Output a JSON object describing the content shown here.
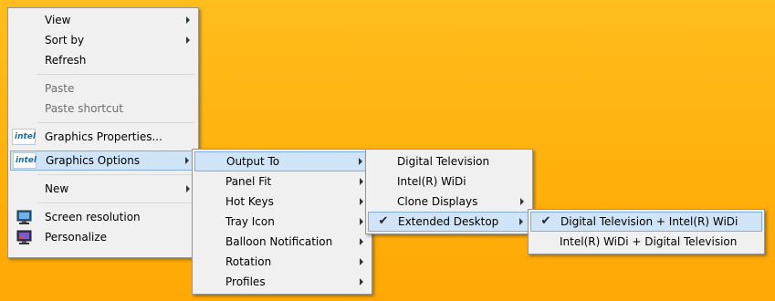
{
  "context_menu": {
    "items": [
      {
        "label": "View"
      },
      {
        "label": "Sort by"
      },
      {
        "label": "Refresh"
      },
      {
        "label": "Paste"
      },
      {
        "label": "Paste shortcut"
      },
      {
        "label": "Graphics Properties..."
      },
      {
        "label": "Graphics Options"
      },
      {
        "label": "New"
      },
      {
        "label": "Screen resolution"
      },
      {
        "label": "Personalize"
      }
    ],
    "intel_icon_text": "intel"
  },
  "graphics_options_menu": {
    "items": [
      {
        "label": "Output To"
      },
      {
        "label": "Panel Fit"
      },
      {
        "label": "Hot Keys"
      },
      {
        "label": "Tray Icon"
      },
      {
        "label": "Balloon Notification"
      },
      {
        "label": "Rotation"
      },
      {
        "label": "Profiles"
      }
    ]
  },
  "output_to_menu": {
    "items": [
      {
        "label": "Digital Television"
      },
      {
        "label": "Intel(R) WiDi"
      },
      {
        "label": "Clone Displays"
      },
      {
        "label": "Extended Desktop"
      }
    ],
    "check_glyph": "✔"
  },
  "extended_desktop_menu": {
    "items": [
      {
        "label": "Digital Television + Intel(R) WiDi"
      },
      {
        "label": "Intel(R) WiDi + Digital Television"
      }
    ],
    "check_glyph": "✔"
  },
  "colors": {
    "desktop": "#ffb10b",
    "menu_bg": "#f0f0f0",
    "highlight_bg": "#cfe4f7",
    "highlight_border": "#84acdd",
    "intel_blue": "#0b72c3"
  }
}
